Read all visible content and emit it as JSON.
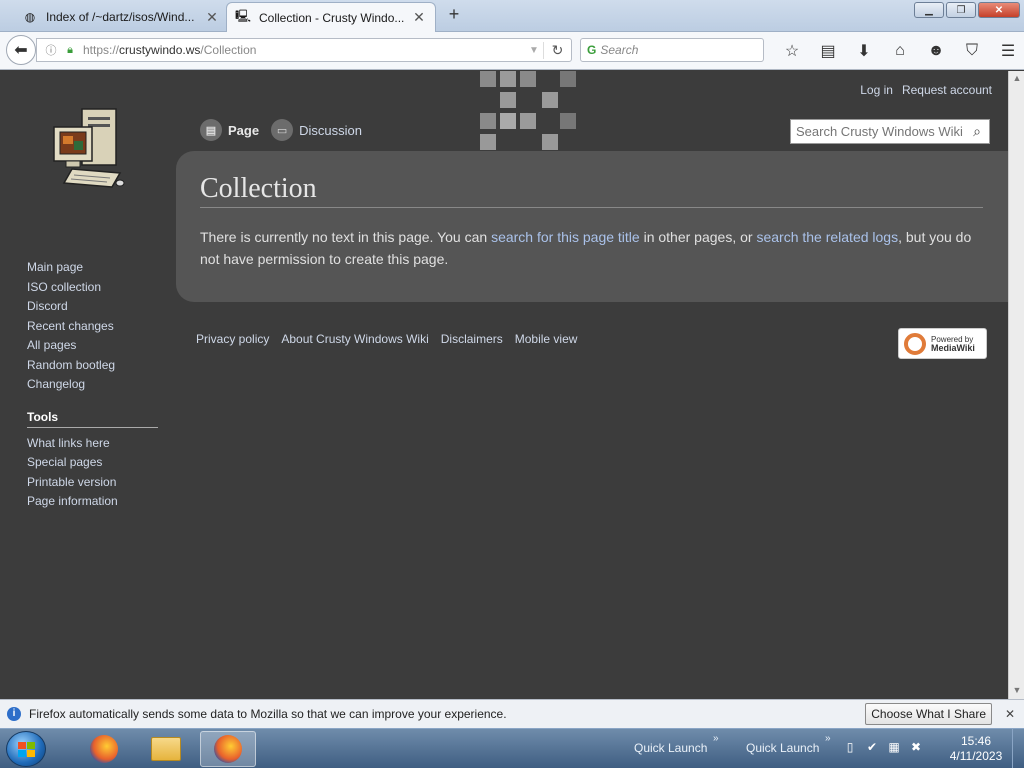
{
  "browser": {
    "tabs": [
      {
        "title": "Index of /~dartz/isos/Wind...",
        "active": false
      },
      {
        "title": "Collection - Crusty Windo...",
        "active": true
      }
    ],
    "url": {
      "host": "crustywindo.ws",
      "scheme": "https://",
      "path": "/Collection"
    },
    "search_placeholder": "Search"
  },
  "wiki": {
    "personal": {
      "login": "Log in",
      "request_account": "Request account"
    },
    "tabs": {
      "page": "Page",
      "discussion": "Discussion"
    },
    "search_placeholder": "Search Crusty Windows Wiki",
    "title": "Collection",
    "body": {
      "part1": "There is currently no text in this page. You can ",
      "link1": "search for this page title",
      "part2": " in other pages, or ",
      "link2": "search the related logs",
      "part3": ", but you do not have permission to create this page."
    },
    "nav": [
      "Main page",
      "ISO collection",
      "Discord",
      "Recent changes",
      "All pages",
      "Random bootleg",
      "Changelog"
    ],
    "tools_heading": "Tools",
    "tools": [
      "What links here",
      "Special pages",
      "Printable version",
      "Page information"
    ],
    "footer": [
      "Privacy policy",
      "About Crusty Windows Wiki",
      "Disclaimers",
      "Mobile view"
    ],
    "badge": {
      "line1": "Powered by",
      "line2": "MediaWiki"
    }
  },
  "notification": {
    "message": "Firefox automatically sends some data to Mozilla so that we can improve your experience.",
    "button": "Choose What I Share"
  },
  "taskbar": {
    "quick_launch_1": "Quick Launch",
    "quick_launch_2": "Quick Launch",
    "time": "15:46",
    "date": "4/11/2023"
  }
}
